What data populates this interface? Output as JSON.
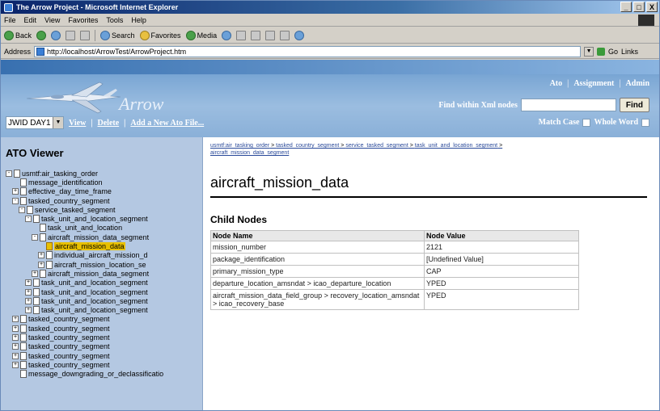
{
  "window": {
    "title": "The Arrow Project - Microsoft Internet Explorer",
    "controls": [
      "_",
      "□",
      "X"
    ]
  },
  "menubar": {
    "items": [
      "File",
      "Edit",
      "View",
      "Favorites",
      "Tools",
      "Help"
    ]
  },
  "toolbar": {
    "back": "Back",
    "search": "Search",
    "favorites": "Favorites",
    "media": "Media"
  },
  "addressbar": {
    "label": "Address",
    "url": "http://localhost/ArrowTest/ArrowProject.htm",
    "go": "Go",
    "links": "Links"
  },
  "app": {
    "brand": "Arrow",
    "nav": [
      "Ato",
      "Assignment",
      "Admin"
    ],
    "find_label": "Find within Xml nodes",
    "find_button": "Find",
    "match_case": "Match Case",
    "whole_word": "Whole Word",
    "ato_selected": "JWID DAY1",
    "view_link": "View",
    "delete_link": "Delete",
    "add_link": "Add a New Ato File..."
  },
  "left": {
    "title": "ATO Viewer",
    "tree": [
      {
        "label": "usmtf:air_tasking_order",
        "exp": "-"
      },
      {
        "label": "message_identification",
        "exp": ""
      },
      {
        "label": "effective_day_time_frame",
        "exp": "+"
      },
      {
        "label": "tasked_country_segment",
        "exp": "-"
      },
      {
        "label": "service_tasked_segment",
        "exp": "-"
      },
      {
        "label": "task_unit_and_location_segment",
        "exp": "-"
      },
      {
        "label": "task_unit_and_location",
        "exp": ""
      },
      {
        "label": "aircraft_mission_data_segment",
        "exp": "-"
      },
      {
        "label": "aircraft_mission_data",
        "exp": "",
        "selected": true
      },
      {
        "label": "individual_aircraft_mission_d",
        "exp": "+"
      },
      {
        "label": "aircraft_mission_location_se",
        "exp": "+"
      },
      {
        "label": "aircraft_mission_data_segment",
        "exp": "+"
      },
      {
        "label": "task_unit_and_location_segment",
        "exp": "+"
      },
      {
        "label": "task_unit_and_location_segment",
        "exp": "+"
      },
      {
        "label": "task_unit_and_location_segment",
        "exp": "+"
      },
      {
        "label": "task_unit_and_location_segment",
        "exp": "+"
      },
      {
        "label": "tasked_country_segment",
        "exp": "+"
      },
      {
        "label": "tasked_country_segment",
        "exp": "+"
      },
      {
        "label": "tasked_country_segment",
        "exp": "+"
      },
      {
        "label": "tasked_country_segment",
        "exp": "+"
      },
      {
        "label": "tasked_country_segment",
        "exp": "+"
      },
      {
        "label": "tasked_country_segment",
        "exp": "+"
      },
      {
        "label": "message_downgrading_or_declassificatio",
        "exp": ""
      }
    ]
  },
  "right": {
    "breadcrumb": [
      "usmtf:air_tasking_order",
      "tasked_country_segment",
      "service_tasked_segment",
      "task_unit_and_location_segment",
      "aircraft_mission_data_segment"
    ],
    "node_title": "aircraft_mission_data",
    "child_nodes_title": "Child Nodes",
    "table": {
      "headers": [
        "Node Name",
        "Node Value"
      ],
      "rows": [
        [
          "mission_number",
          "2121"
        ],
        [
          "package_identification",
          "[Undefined Value]"
        ],
        [
          "primary_mission_type",
          "CAP"
        ],
        [
          "departure_location_amsndat > icao_departure_location",
          "YPED"
        ],
        [
          "aircraft_mission_data_field_group > recovery_location_amsndat > icao_recovery_base",
          "YPED"
        ]
      ]
    }
  }
}
